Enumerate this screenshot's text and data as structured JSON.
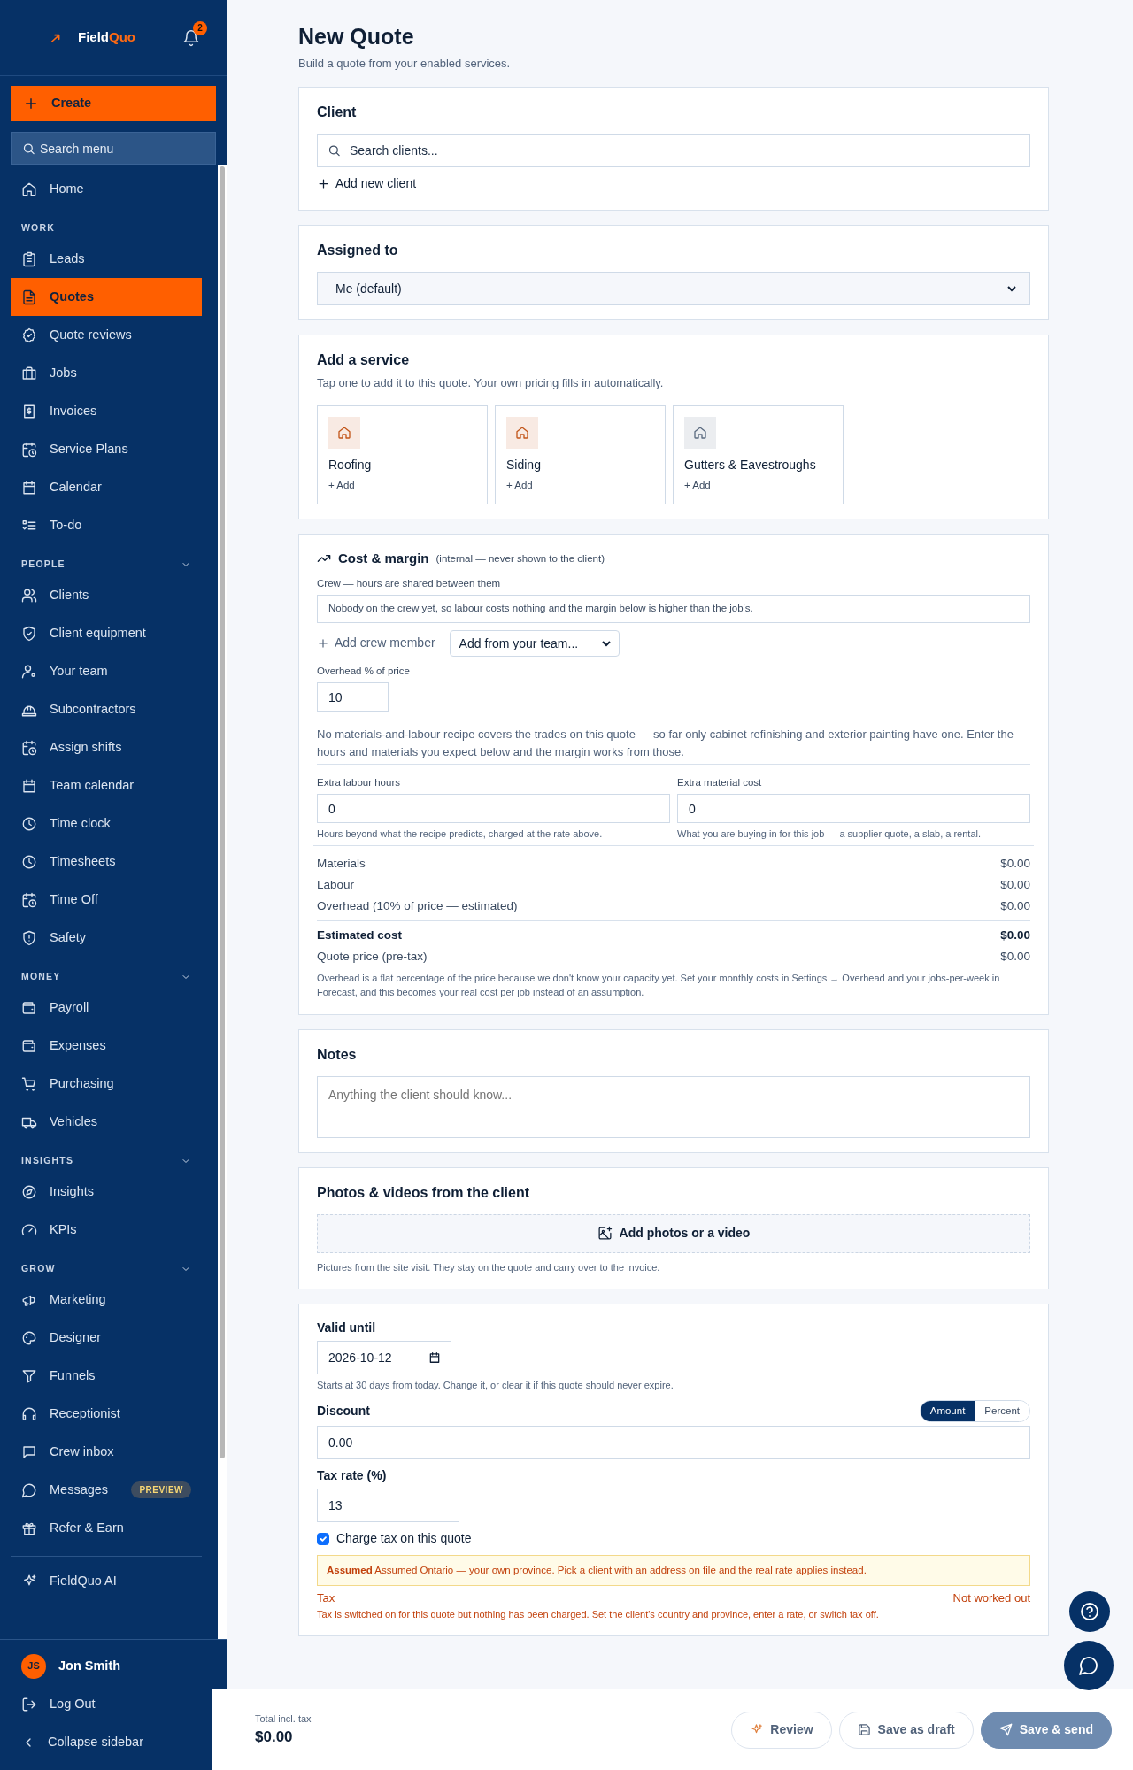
{
  "sidebar": {
    "brand": {
      "text": "Field",
      "accent": "Quo"
    },
    "notification_count": "2",
    "create_button": "Create",
    "search": {
      "placeholder": "Search menu"
    },
    "sections": [
      {
        "items": [
          {
            "label": "Home",
            "selected": false
          }
        ]
      },
      {
        "heading": "WORK",
        "items": [
          {
            "label": "Leads",
            "selected": false
          },
          {
            "label": "Quotes",
            "selected": true
          },
          {
            "label": "Quote reviews",
            "selected": false
          },
          {
            "label": "Jobs",
            "selected": false
          },
          {
            "label": "Invoices",
            "selected": false
          },
          {
            "label": "Service Plans",
            "selected": false
          },
          {
            "label": "Calendar",
            "selected": false
          },
          {
            "label": "To-do",
            "selected": false
          }
        ]
      },
      {
        "heading": "PEOPLE",
        "expanded": true,
        "items": [
          {
            "label": "Clients",
            "selected": false
          },
          {
            "label": "Client equipment",
            "selected": false
          },
          {
            "label": "Your team",
            "selected": false
          },
          {
            "label": "Subcontractors",
            "selected": false
          },
          {
            "label": "Assign shifts",
            "selected": false
          },
          {
            "label": "Team calendar",
            "selected": false
          },
          {
            "label": "Time clock",
            "selected": false
          },
          {
            "label": "Timesheets",
            "selected": false
          },
          {
            "label": "Time Off",
            "selected": false
          },
          {
            "label": "Safety",
            "selected": false
          }
        ]
      },
      {
        "heading": "MONEY",
        "expanded": true,
        "items": [
          {
            "label": "Payroll",
            "selected": false
          },
          {
            "label": "Expenses",
            "selected": false
          },
          {
            "label": "Purchasing",
            "selected": false
          },
          {
            "label": "Vehicles",
            "selected": false
          }
        ]
      },
      {
        "heading": "INSIGHTS",
        "expanded": true,
        "items": [
          {
            "label": "Insights",
            "selected": false
          },
          {
            "label": "KPIs",
            "selected": false
          }
        ]
      },
      {
        "heading": "GROW",
        "expanded": true,
        "items": [
          {
            "label": "Marketing",
            "selected": false
          },
          {
            "label": "Designer",
            "selected": false
          },
          {
            "label": "Funnels",
            "selected": false
          },
          {
            "label": "Receptionist",
            "selected": false
          },
          {
            "label": "Crew inbox",
            "selected": false
          },
          {
            "label": "Messages",
            "selected": false,
            "badge": "PREVIEW"
          },
          {
            "label": "Refer & Earn",
            "selected": false
          }
        ]
      },
      {
        "divider": true,
        "items": [
          {
            "label": "FieldQuo AI",
            "selected": false
          }
        ]
      }
    ],
    "user": {
      "initials": "JS",
      "name": "Jon Smith"
    },
    "log_out": "Log Out",
    "collapse": "Collapse sidebar"
  },
  "page": {
    "title": "New Quote",
    "subtitle": "Build a quote from your enabled services."
  },
  "client": {
    "title": "Client",
    "search": {
      "placeholder": "Search clients..."
    },
    "add_link": "Add new client"
  },
  "assigned": {
    "title": "Assigned to",
    "value": "Me (default)"
  },
  "services": {
    "title": "Add a service",
    "description": "Tap one to add it to this quote. Your own pricing fills in automatically.",
    "items": [
      {
        "name": "Roofing",
        "action": "+ Add",
        "color": "#c2561a"
      },
      {
        "name": "Siding",
        "action": "+ Add",
        "color": "#c2561a"
      },
      {
        "name": "Gutters & Eavestroughs",
        "action": "+ Add",
        "color": "#5b6b80"
      }
    ]
  },
  "cost": {
    "title": "Cost & margin",
    "note": "(internal — never shown to the client)",
    "crew_label": "Crew — hours are shared between them",
    "crew_empty": "Nobody on the crew yet, so labour costs nothing and the margin below is higher than the job's.",
    "add_crew": "Add crew member",
    "crew_select": "Add from your team...",
    "overhead_label": "Overhead % of price",
    "overhead_value": "10",
    "recipe_note": "No materials-and-labour recipe covers the trades on this quote — so far only cabinet refinishing and exterior painting have one. Enter the hours and materials you expect below and the margin works from those.",
    "extras": [
      {
        "label": "Extra labour hours",
        "value": "0",
        "hint": "Hours beyond what the recipe predicts, charged at the rate above."
      },
      {
        "label": "Extra material cost",
        "value": "0",
        "hint": "What you are buying in for this job — a supplier quote, a slab, a rental."
      }
    ],
    "lines": [
      {
        "kind": "line",
        "label": "Materials",
        "value": "$0.00"
      },
      {
        "kind": "line",
        "label": "Labour",
        "value": "$0.00"
      },
      {
        "kind": "line",
        "label": "Overhead (10% of price — estimated)",
        "value": "$0.00"
      },
      {
        "kind": "total",
        "label": "Estimated cost",
        "value": "$0.00"
      },
      {
        "kind": "line",
        "label": "Quote price (pre-tax)",
        "value": "$0.00"
      }
    ],
    "footnote": "Overhead is a flat percentage of the price because we don't know your capacity yet. Set your monthly costs in Settings → Overhead and your jobs-per-week in Forecast, and this becomes your real cost per job instead of an assumption."
  },
  "notes": {
    "title": "Notes",
    "placeholder": "Anything the client should know..."
  },
  "photos": {
    "title": "Photos & videos from the client",
    "button": "Add photos or a video",
    "hint": "Pictures from the site visit. They stay on the quote and carry over to the invoice."
  },
  "terms": {
    "valid_label": "Valid until",
    "valid_value": "2026-10-12",
    "valid_hint": "Starts at 30 days from today. Change it, or clear it if this quote should never expire.",
    "discount_label": "Discount",
    "discount_modes": [
      {
        "label": "Amount",
        "selected": true
      },
      {
        "label": "Percent",
        "selected": false
      }
    ],
    "discount_value": "0.00",
    "tax_label": "Tax rate (%)",
    "tax_value": "13",
    "charge_tax": {
      "label": "Charge tax on this quote",
      "checked": true
    },
    "warning": "**Assumed** Assumed Ontario — your own province. Pick a client with an address on file and the real rate applies instead.",
    "tax_row": {
      "label": "Tax",
      "value": "Not worked out"
    },
    "tax_error": "Tax is switched on for this quote but nothing has been charged. Set the client's country and province, enter a rate, or switch tax off."
  },
  "footer": {
    "total_label": "Total incl. tax",
    "total_value": "$0.00",
    "buttons": [
      {
        "kind": "review",
        "label": "Review"
      },
      {
        "kind": "draft",
        "label": "Save as draft"
      },
      {
        "kind": "send",
        "label": "Save & send"
      }
    ]
  }
}
